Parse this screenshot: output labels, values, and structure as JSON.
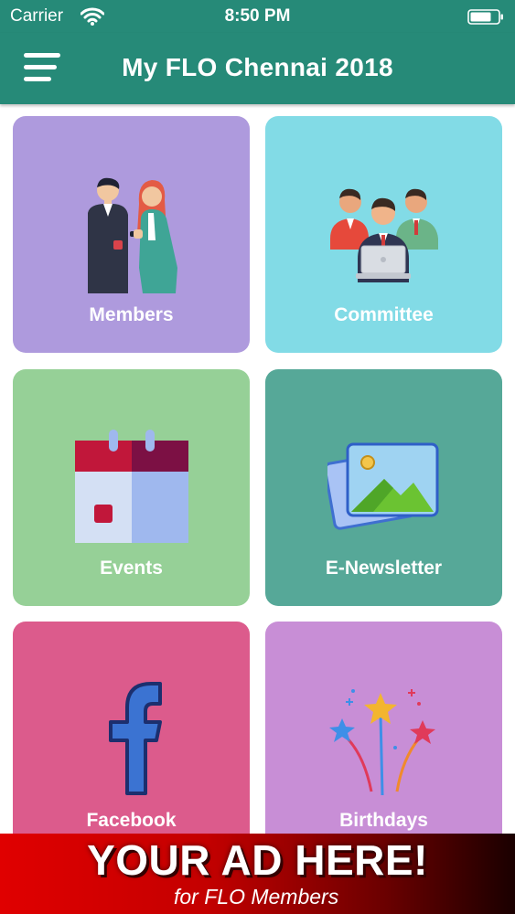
{
  "status_bar": {
    "carrier": "Carrier",
    "time": "8:50 PM"
  },
  "nav": {
    "title": "My FLO Chennai 2018"
  },
  "tiles": [
    {
      "label": "Members",
      "color": "#ae9add"
    },
    {
      "label": "Committee",
      "color": "#82dbe6"
    },
    {
      "label": "Events",
      "color": "#96d097"
    },
    {
      "label": "E-Newsletter",
      "color": "#56a898"
    },
    {
      "label": "Facebook",
      "color": "#dc5b8c"
    },
    {
      "label": "Birthdays",
      "color": "#c88ed6"
    }
  ],
  "ad": {
    "headline": "YOUR AD HERE!",
    "subtext": "for FLO Members"
  },
  "colors": {
    "header": "#268a78",
    "ad_red": "#e00000"
  }
}
